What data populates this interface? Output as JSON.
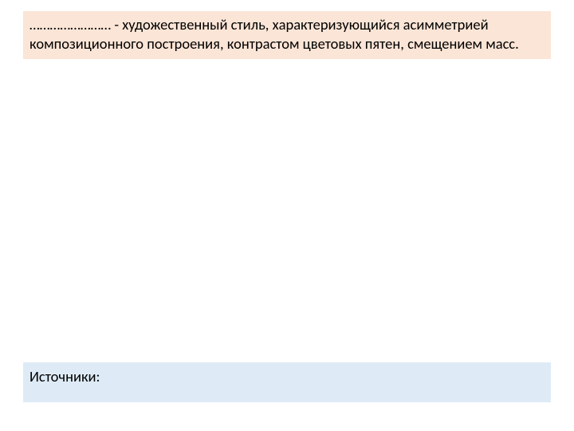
{
  "definition": {
    "text": "…………………… - художественный стиль, характеризующийся асимметрией композиционного построения, контрастом цветовых пятен, смещением масс."
  },
  "sources": {
    "label": "Источники:"
  }
}
